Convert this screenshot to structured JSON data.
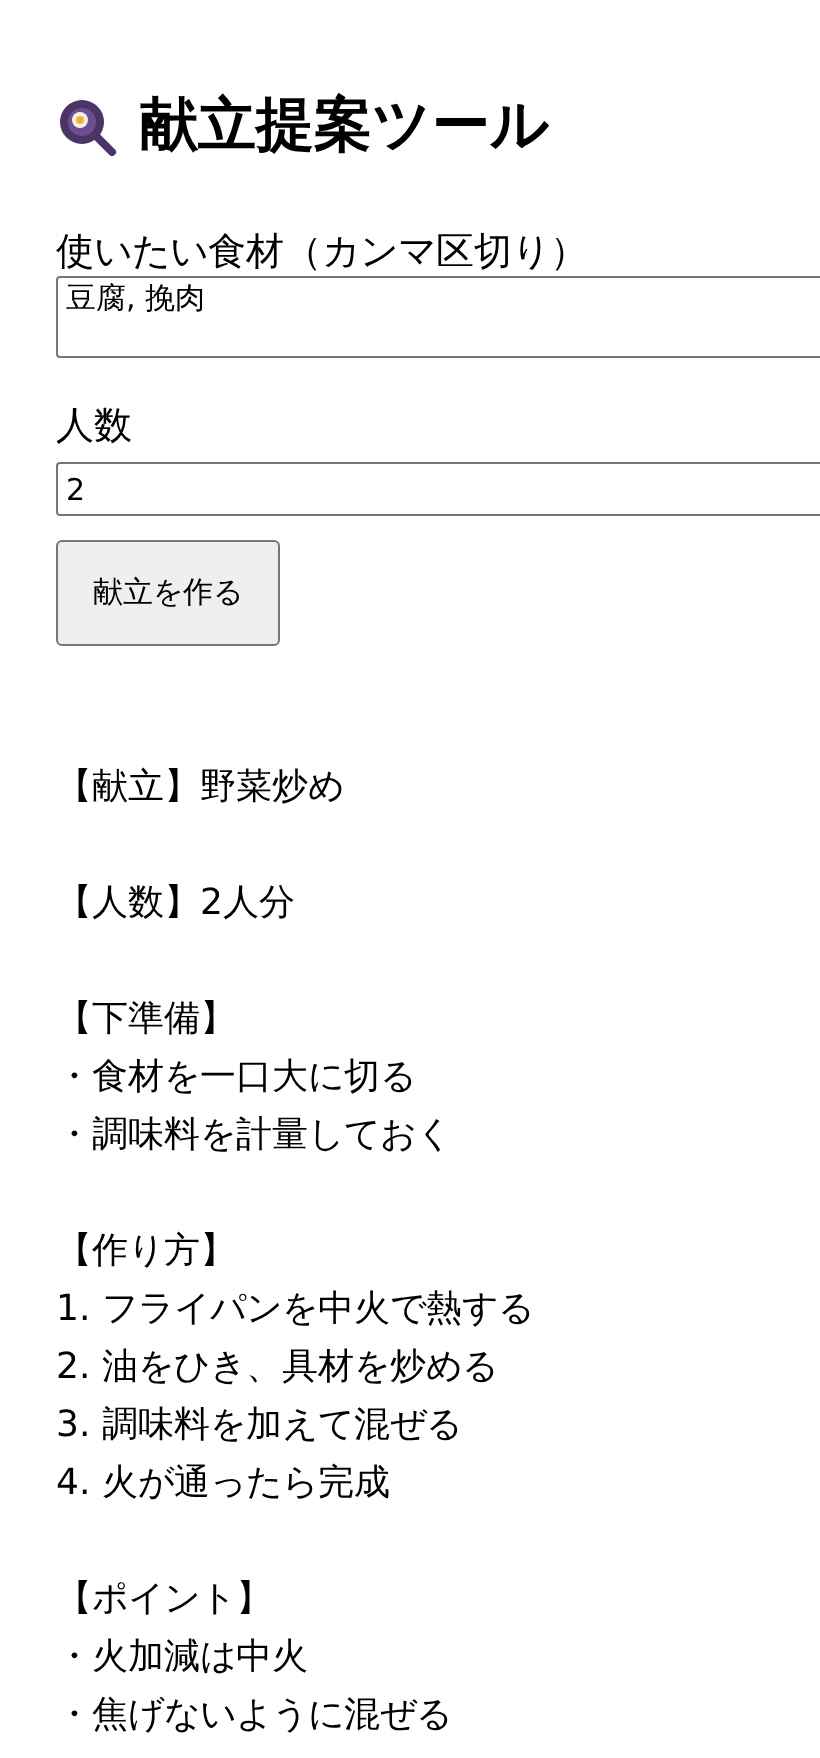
{
  "title": "献立提案ツール",
  "form": {
    "ingredients_label": "使いたい食材（カンマ区切り）",
    "ingredients_value": "豆腐, 挽肉",
    "servings_label": "人数",
    "servings_value": "2",
    "submit": "献立を作る"
  },
  "result": [
    {
      "lines": [
        "【献立】野菜炒め"
      ]
    },
    {
      "lines": [
        "【人数】2人分"
      ]
    },
    {
      "lines": [
        "【下準備】",
        "・食材を一口大に切る",
        "・調味料を計量しておく"
      ]
    },
    {
      "lines": [
        "【作り方】",
        "1. フライパンを中火で熱する",
        "2. 油をひき、具材を炒める",
        "3. 調味料を加えて混ぜる",
        "4. 火が通ったら完成"
      ]
    },
    {
      "lines": [
        "【ポイント】",
        "・火加減は中火",
        "・焦げないように混ぜる"
      ]
    }
  ]
}
